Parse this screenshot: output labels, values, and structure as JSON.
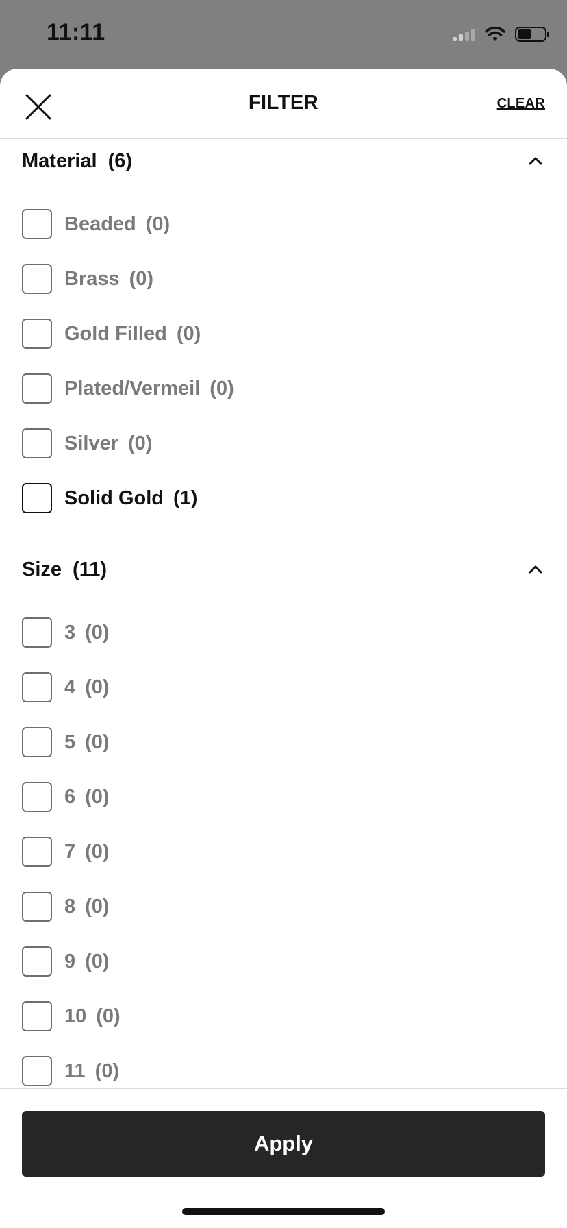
{
  "status_bar": {
    "time": "11:11",
    "battery_level": 0.55
  },
  "header": {
    "close_icon": "close-icon",
    "title": "FILTER",
    "clear_label": "CLEAR"
  },
  "sections": [
    {
      "title": "Material",
      "count": "(6)",
      "expanded": true,
      "icon": "chevron-up-icon",
      "options": [
        {
          "label": "Beaded",
          "count": "(0)",
          "enabled": false,
          "checked": false
        },
        {
          "label": "Brass",
          "count": "(0)",
          "enabled": false,
          "checked": false
        },
        {
          "label": "Gold Filled",
          "count": "(0)",
          "enabled": false,
          "checked": false
        },
        {
          "label": "Plated/Vermeil",
          "count": "(0)",
          "enabled": false,
          "checked": false
        },
        {
          "label": "Silver",
          "count": "(0)",
          "enabled": false,
          "checked": false
        },
        {
          "label": "Solid Gold",
          "count": "(1)",
          "enabled": true,
          "checked": false
        }
      ]
    },
    {
      "title": "Size",
      "count": "(11)",
      "expanded": true,
      "icon": "chevron-up-icon",
      "options": [
        {
          "label": "3",
          "count": "(0)",
          "enabled": false,
          "checked": false
        },
        {
          "label": "4",
          "count": "(0)",
          "enabled": false,
          "checked": false
        },
        {
          "label": "5",
          "count": "(0)",
          "enabled": false,
          "checked": false
        },
        {
          "label": "6",
          "count": "(0)",
          "enabled": false,
          "checked": false
        },
        {
          "label": "7",
          "count": "(0)",
          "enabled": false,
          "checked": false
        },
        {
          "label": "8",
          "count": "(0)",
          "enabled": false,
          "checked": false
        },
        {
          "label": "9",
          "count": "(0)",
          "enabled": false,
          "checked": false
        },
        {
          "label": "10",
          "count": "(0)",
          "enabled": false,
          "checked": false
        },
        {
          "label": "11",
          "count": "(0)",
          "enabled": false,
          "checked": false
        }
      ]
    }
  ],
  "footer": {
    "apply_label": "Apply"
  },
  "colors": {
    "backdrop": "#808080",
    "disabled_text": "#7a7a7a",
    "enabled_text": "#111111",
    "apply_button": "#262626"
  }
}
